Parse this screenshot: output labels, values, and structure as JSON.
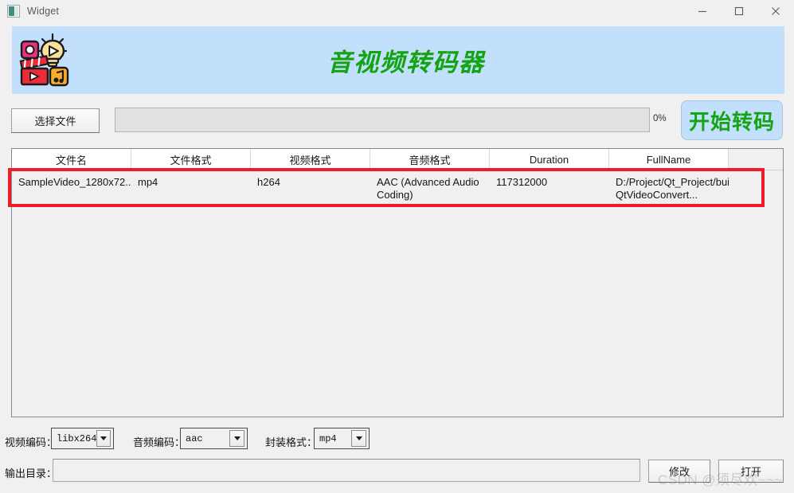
{
  "window": {
    "title": "Widget",
    "icon": "app-icon",
    "controls": {
      "minimize": "minimize-icon",
      "maximize": "maximize-icon",
      "close": "close-icon"
    }
  },
  "banner": {
    "title": "音视频转码器",
    "background_color": "#c2dffc",
    "title_color": "#13a313",
    "logo": "video-audio-converter-logo"
  },
  "toolbar": {
    "choose_file_label": "选择文件",
    "progress_value": 0,
    "progress_text": "0%",
    "start_label": "开始转码",
    "start_bg_color": "#c2dffc",
    "start_text_color": "#13a313"
  },
  "table": {
    "columns": [
      "文件名",
      "文件格式",
      "视频格式",
      "音频格式",
      "Duration",
      "FullName",
      ""
    ],
    "rows": [
      {
        "file_name": "SampleVideo_1280x72...",
        "file_format": "mp4",
        "video_format": "h264",
        "audio_format": "AAC (Advanced Audio Coding)",
        "duration": "117312000",
        "full_name": "D:/Project/Qt_Project/build-QtVideoConvert..."
      }
    ],
    "annotation_color": "#ee1c24"
  },
  "encoding": {
    "video_label": "视频编码：",
    "video_value": "libx264",
    "audio_label": "音频编码：",
    "audio_value": "aac",
    "container_label": "封装格式：",
    "container_value": "mp4"
  },
  "output": {
    "label": "输出目录：",
    "value": "",
    "modify_label": "修改",
    "open_label": "打开"
  },
  "watermark": {
    "text": "CSDN @须尽欢~~~"
  }
}
